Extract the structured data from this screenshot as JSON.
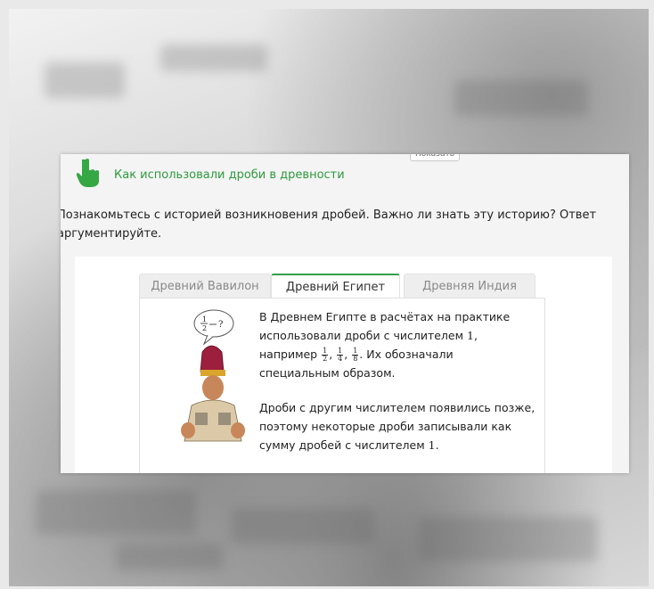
{
  "page": {
    "background": "#e9e9e9"
  },
  "card": {
    "show_button": "Показать",
    "title": "Как использовали дроби в древности",
    "title_color": "#2e9a3e",
    "hand_icon": "pointing-hand-icon",
    "description": "Познакомьтесь с историей возникновения дробей. Важно ли знать эту историю? Ответ аргументируйте."
  },
  "tabs": [
    {
      "label": "Древний Вавилон",
      "active": false
    },
    {
      "label": "Древний Египет",
      "active": true
    },
    {
      "label": "Древняя Индия",
      "active": false
    }
  ],
  "accent": "#33a04a",
  "content": {
    "bubble_text": "?",
    "p1_line1": "В Древнем Египте в расчётах на практике",
    "p1_line2_pre": "использовали дроби с числителем ",
    "p1_numerator_value": "1",
    "p1_line2_post": ",",
    "p1_line3_pre": "например ",
    "fractions": [
      {
        "num": "1",
        "den": "2"
      },
      {
        "num": "1",
        "den": "4"
      },
      {
        "num": "1",
        "den": "8"
      }
    ],
    "p1_line3_post": ". Их обозначали",
    "p1_line4": "специальным образом.",
    "p2_line1": "Дроби с другим числителем появились позже,",
    "p2_line2": "поэтому некоторые дроби записывали как",
    "p2_line3_pre": "сумму дробей с числителем ",
    "p2_value": "1",
    "p2_line3_post": "."
  }
}
